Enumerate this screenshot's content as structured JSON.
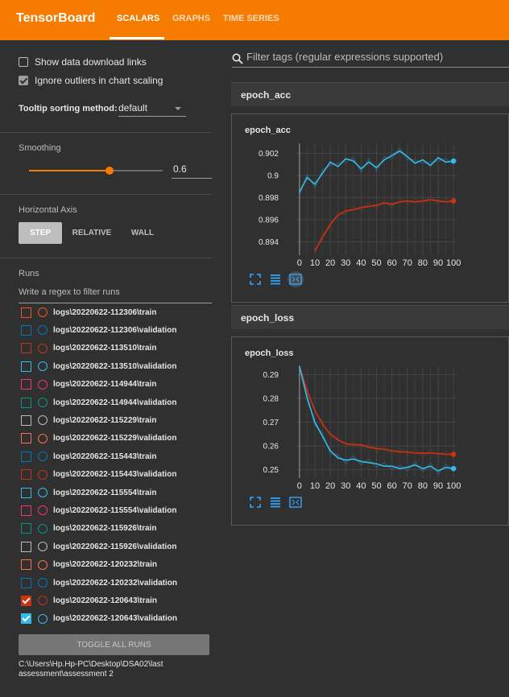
{
  "header": {
    "brand": "TensorBoard",
    "tabs": [
      "SCALARS",
      "GRAPHS",
      "TIME SERIES"
    ],
    "active_tab": "SCALARS"
  },
  "sidebar": {
    "show_download_links": {
      "label": "Show data download links",
      "checked": false
    },
    "ignore_outliers": {
      "label": "Ignore outliers in chart scaling",
      "checked": true
    },
    "tooltip_sorting": {
      "label": "Tooltip sorting method:",
      "value": "default"
    },
    "smoothing": {
      "title": "Smoothing",
      "value": "0.6",
      "level": 0.6
    },
    "horizontal_axis": {
      "title": "Horizontal Axis",
      "options": [
        "STEP",
        "RELATIVE",
        "WALL"
      ],
      "selected": "STEP"
    },
    "runs": {
      "title": "Runs",
      "filter_placeholder": "Write a regex to filter runs",
      "items": [
        {
          "label": "logs\\20220622-112306\\train",
          "color": "#f4511e",
          "checked": false
        },
        {
          "label": "logs\\20220622-112306\\validation",
          "color": "#0277bd",
          "checked": false
        },
        {
          "label": "logs\\20220622-113510\\train",
          "color": "#cc3311",
          "checked": false
        },
        {
          "label": "logs\\20220622-113510\\validation",
          "color": "#33bbee",
          "checked": false
        },
        {
          "label": "logs\\20220622-114944\\train",
          "color": "#ee3377",
          "checked": false
        },
        {
          "label": "logs\\20220622-114944\\validation",
          "color": "#009988",
          "checked": false
        },
        {
          "label": "logs\\20220622-115229\\train",
          "color": "#bbbbbb",
          "checked": false
        },
        {
          "label": "logs\\20220622-115229\\validation",
          "color": "#ff7043",
          "checked": false
        },
        {
          "label": "logs\\20220622-115443\\train",
          "color": "#0077bb",
          "checked": false
        },
        {
          "label": "logs\\20220622-115443\\validation",
          "color": "#cc3311",
          "checked": false
        },
        {
          "label": "logs\\20220622-115554\\train",
          "color": "#33bbee",
          "checked": false
        },
        {
          "label": "logs\\20220622-115554\\validation",
          "color": "#ee3377",
          "checked": false
        },
        {
          "label": "logs\\20220622-115926\\train",
          "color": "#009988",
          "checked": false
        },
        {
          "label": "logs\\20220622-115926\\validation",
          "color": "#bbbbbb",
          "checked": false
        },
        {
          "label": "logs\\20220622-120232\\train",
          "color": "#ff7043",
          "checked": false
        },
        {
          "label": "logs\\20220622-120232\\validation",
          "color": "#0077bb",
          "checked": false
        },
        {
          "label": "logs\\20220622-120643\\train",
          "color": "#cc3311",
          "checked": true
        },
        {
          "label": "logs\\20220622-120643\\validation",
          "color": "#33bbee",
          "checked": true
        }
      ],
      "toggle_all_label": "TOGGLE ALL RUNS",
      "logdir": "C:\\Users\\Hp.Hp-PC\\Desktop\\DSA02\\last assessment\\assessment 2"
    }
  },
  "main": {
    "filter_placeholder": "Filter tags (regular expressions supported)",
    "groups": [
      {
        "name": "epoch_acc"
      },
      {
        "name": "epoch_loss"
      }
    ],
    "tool_icons": [
      "fit-to-data-icon",
      "data-table-icon",
      "fullscreen-icon"
    ]
  },
  "chart_data": [
    {
      "type": "line",
      "title": "epoch_acc",
      "xlabel": "",
      "ylabel": "",
      "xlim": [
        -2,
        102
      ],
      "ylim": [
        0.8928,
        0.9029
      ],
      "xticks": [
        0,
        10,
        20,
        30,
        40,
        50,
        60,
        70,
        80,
        90,
        100
      ],
      "yticks": [
        "0.894",
        "0.896",
        "0.898",
        "0.9",
        "0.902"
      ],
      "ytick_values": [
        0.894,
        0.896,
        0.898,
        0.9,
        0.902
      ],
      "grid": true,
      "series": [
        {
          "color": "#33bbee",
          "x": [
            0,
            5,
            10,
            15,
            20,
            25,
            30,
            35,
            40,
            45,
            50,
            55,
            60,
            65,
            70,
            75,
            80,
            85,
            90,
            95,
            100
          ],
          "y": [
            0.8985,
            0.8998,
            0.8992,
            0.9002,
            0.9012,
            0.9008,
            0.9015,
            0.9013,
            0.9006,
            0.9012,
            0.9007,
            0.9014,
            0.9018,
            0.9022,
            0.9017,
            0.9011,
            0.9014,
            0.9009,
            0.9016,
            0.9012,
            0.9013
          ]
        },
        {
          "color": "#cc3311",
          "x": [
            10,
            15,
            20,
            25,
            30,
            35,
            40,
            45,
            50,
            55,
            60,
            65,
            70,
            75,
            80,
            85,
            90,
            95,
            100
          ],
          "y": [
            0.8932,
            0.8944,
            0.8956,
            0.8964,
            0.8968,
            0.8969,
            0.8971,
            0.8972,
            0.8973,
            0.8975,
            0.8974,
            0.8976,
            0.8977,
            0.8976,
            0.8977,
            0.8978,
            0.8977,
            0.8976,
            0.8977
          ]
        }
      ]
    },
    {
      "type": "line",
      "title": "epoch_loss",
      "xlabel": "",
      "ylabel": "",
      "xlim": [
        -2,
        102
      ],
      "ylim": [
        0.2465,
        0.2935
      ],
      "xticks": [
        0,
        10,
        20,
        30,
        40,
        50,
        60,
        70,
        80,
        90,
        100
      ],
      "yticks": [
        "0.25",
        "0.26",
        "0.27",
        "0.28",
        "0.29"
      ],
      "ytick_values": [
        0.25,
        0.26,
        0.27,
        0.28,
        0.29
      ],
      "grid": true,
      "series": [
        {
          "color": "#cc3311",
          "x": [
            0,
            5,
            10,
            15,
            20,
            25,
            30,
            35,
            40,
            45,
            50,
            55,
            60,
            65,
            70,
            75,
            80,
            85,
            90,
            95,
            100
          ],
          "y": [
            0.2935,
            0.283,
            0.275,
            0.269,
            0.265,
            0.2625,
            0.261,
            0.2605,
            0.2605,
            0.2595,
            0.259,
            0.2585,
            0.258,
            0.2575,
            0.2575,
            0.257,
            0.257,
            0.257,
            0.2568,
            0.2565,
            0.2565
          ]
        },
        {
          "color": "#33bbee",
          "x": [
            0,
            5,
            10,
            15,
            20,
            25,
            30,
            35,
            40,
            45,
            50,
            55,
            60,
            65,
            70,
            75,
            80,
            85,
            90,
            95,
            100
          ],
          "y": [
            0.2935,
            0.28,
            0.27,
            0.264,
            0.258,
            0.255,
            0.254,
            0.2545,
            0.2535,
            0.253,
            0.2525,
            0.2515,
            0.2515,
            0.2505,
            0.251,
            0.252,
            0.2505,
            0.2515,
            0.2495,
            0.251,
            0.2505
          ]
        }
      ]
    }
  ]
}
